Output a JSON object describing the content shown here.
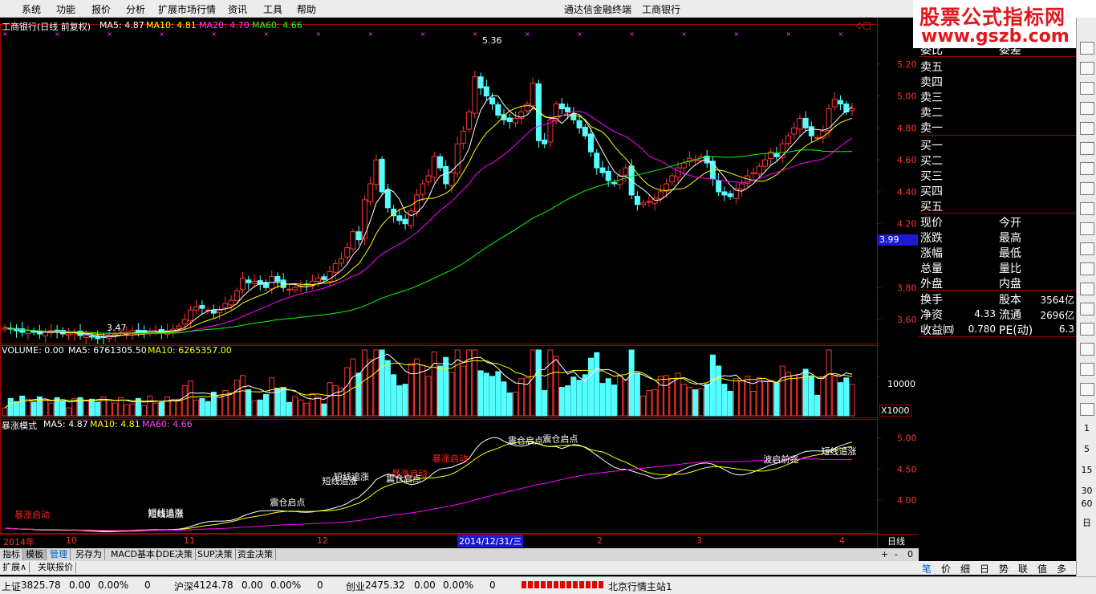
{
  "menu": {
    "items": [
      "系统",
      "功能",
      "报价",
      "分析",
      "扩展市场行情",
      "资讯",
      "工具",
      "帮助"
    ],
    "app_title": "通达信金融终端",
    "stock": "工商银行"
  },
  "watermark": {
    "line1": "股票公式指标网",
    "line2": "www.gszb.com"
  },
  "main_panel": {
    "header_name": "工商银行(日线 前复权)",
    "ma5": "MA5: 4.87",
    "ma10": "MA10: 4.81",
    "ma20": "MA20: 4.70",
    "ma60": "MA60: 4.66",
    "high_label": "5.36",
    "low_label": "3.47",
    "price_flag": "3.99",
    "right_marks": "◇□"
  },
  "volume_panel": {
    "header": "VOLUME: 0.00",
    "ma5": "MA5: 6761305.50",
    "ma10": "MA10: 6265357.00",
    "tick": "10000",
    "unit": "X1000"
  },
  "indicator_panel": {
    "header": "暴涨模式",
    "ma5": "MA5: 4.87",
    "ma10": "MA10: 4.81",
    "ma60": "MA60: 4.66"
  },
  "x_axis": {
    "labels": [
      "2014年",
      "10",
      "11",
      "12",
      "2014/12/31/三",
      "2",
      "3",
      "4"
    ],
    "period": "日线"
  },
  "chart_data": {
    "type": "candlestick",
    "price_axis": {
      "ticks": [
        5.2,
        5.0,
        4.8,
        4.6,
        4.4,
        4.2,
        3.8,
        3.6
      ],
      "range": [
        3.5,
        5.4
      ]
    },
    "indicator_axis": {
      "ticks": [
        5.0,
        4.5,
        4.0
      ],
      "range": [
        3.55,
        5.2
      ]
    },
    "closes": [
      3.55,
      3.54,
      3.53,
      3.52,
      3.53,
      3.52,
      3.51,
      3.52,
      3.53,
      3.52,
      3.51,
      3.51,
      3.52,
      3.5,
      3.5,
      3.49,
      3.48,
      3.49,
      3.5,
      3.51,
      3.52,
      3.52,
      3.53,
      3.52,
      3.52,
      3.53,
      3.53,
      3.52,
      3.53,
      3.54,
      3.56,
      3.6,
      3.66,
      3.68,
      3.67,
      3.66,
      3.64,
      3.66,
      3.7,
      3.72,
      3.78,
      3.86,
      3.83,
      3.84,
      3.82,
      3.8,
      3.87,
      3.84,
      3.8,
      3.79,
      3.8,
      3.81,
      3.82,
      3.84,
      3.86,
      3.85,
      3.9,
      3.95,
      3.98,
      4.05,
      4.15,
      4.1,
      4.35,
      4.45,
      4.6,
      4.4,
      4.3,
      4.25,
      4.22,
      4.2,
      4.28,
      4.38,
      4.45,
      4.5,
      4.62,
      4.55,
      4.45,
      4.52,
      4.7,
      4.78,
      4.9,
      5.12,
      5.05,
      5.0,
      4.95,
      4.88,
      4.85,
      4.84,
      4.86,
      4.9,
      4.95,
      5.08,
      4.72,
      4.7,
      4.85,
      4.95,
      4.92,
      4.9,
      4.85,
      4.8,
      4.75,
      4.65,
      4.55,
      4.52,
      4.47,
      4.45,
      4.5,
      4.55,
      4.38,
      4.32,
      4.33,
      4.34,
      4.36,
      4.4,
      4.45,
      4.5,
      4.55,
      4.58,
      4.61,
      4.6,
      4.62,
      4.58,
      4.48,
      4.4,
      4.38,
      4.37,
      4.42,
      4.45,
      4.5,
      4.52,
      4.56,
      4.6,
      4.65,
      4.62,
      4.7,
      4.75,
      4.8,
      4.86,
      4.8,
      4.75,
      4.74,
      4.78,
      4.92,
      4.98,
      4.95,
      4.9,
      4.92
    ],
    "series": [
      {
        "name": "MA5",
        "value": 4.87
      },
      {
        "name": "MA10",
        "value": 4.81
      },
      {
        "name": "MA20",
        "value": 4.7
      },
      {
        "name": "MA60",
        "value": 4.66
      }
    ],
    "signals": [
      {
        "text": "暴涨启动",
        "color": "#ff2020",
        "x_index": 8,
        "y": 3.68
      },
      {
        "text": "短线追涨",
        "color": "#ffffff",
        "x_index": 44,
        "y": 3.71
      },
      {
        "text": "短线追涨",
        "color": "#ffffff",
        "x_index": 43,
        "y": 3.69
      },
      {
        "text": "震仓启点",
        "color": "#ffffff",
        "x_index": 77,
        "y": 3.88
      },
      {
        "text": "短线追涨",
        "color": "#ffffff",
        "x_index": 93,
        "y": 4.29
      },
      {
        "text": "短线追涨",
        "color": "#ffffff",
        "x_index": 91,
        "y": 4.22
      },
      {
        "text": "暴涨启动",
        "color": "#ff2020",
        "x_index": 110,
        "y": 4.34
      },
      {
        "text": "震仓启点",
        "color": "#ffffff",
        "x_index": 107,
        "y": 4.26
      },
      {
        "text": "暴涨启动",
        "color": "#ff2020",
        "x_index": 121,
        "y": 4.58
      },
      {
        "text": "震仓启点",
        "color": "#ffffff",
        "x_index": 141,
        "y": 4.87
      },
      {
        "text": "震仓启点",
        "color": "#ffffff",
        "x_index": 150,
        "y": 4.9
      },
      {
        "text": "波启前兆",
        "color": "#ffffff",
        "x_index": 209,
        "y": 4.57
      },
      {
        "text": "短线追涨",
        "color": "#ffffff",
        "x_index": 225,
        "y": 4.7
      }
    ]
  },
  "quote": {
    "weibi": "委比",
    "weicha": "委差",
    "sell": [
      "卖五",
      "卖四",
      "卖三",
      "卖二",
      "卖一"
    ],
    "buy": [
      "买一",
      "买二",
      "买三",
      "买四",
      "买五"
    ],
    "xianjia": "现价",
    "jinkai": "今开",
    "zhangdie": "涨跌",
    "zuigao": "最高",
    "zhangfu": "涨幅",
    "zuidi": "最低",
    "zongliang": "总量",
    "liangbi": "量比",
    "waipan": "外盘",
    "neipan": "内盘",
    "huanshou": "换手",
    "guben": "股本",
    "guben_val": "3564亿",
    "jingzi": "净资",
    "jingzi_val": "4.33",
    "liutong": "流通",
    "liutong_val": "2696亿",
    "shouyi": "收益㈣",
    "shouyi_val": "0.780",
    "pe": "PE(动)",
    "pe_val": "6.3"
  },
  "tabs": [
    "指标",
    "模板",
    "管理",
    "另存为",
    "MACD基本",
    "DDE决策",
    "SUP决策",
    "资金决策"
  ],
  "tabs2": [
    "扩展∧",
    "关联报价"
  ],
  "tab_controls": [
    "+",
    "-",
    "0"
  ],
  "right_tabs": [
    "笔",
    "价",
    "细",
    "日",
    "势",
    "联",
    "值",
    "多"
  ],
  "right_numbers": [
    "1",
    "5",
    "15",
    "30",
    "60",
    "日"
  ],
  "status": {
    "sh": "上证",
    "sh_val": "3825.78",
    "sh_chg": "0.00",
    "sh_pct": "0.00%",
    "sh_vol": "0",
    "hs": "沪深",
    "hs_val": "4124.78",
    "hs_chg": "0.00",
    "hs_pct": "0.00%",
    "hs_vol": "0",
    "cy": "创业",
    "cy_val": "2475.32",
    "cy_chg": "0.00",
    "cy_pct": "0.00%",
    "cy_vol": "0",
    "server": "北京行情主站1"
  },
  "colors": {
    "up": "#ff3232",
    "down": "#54ffff",
    "ma5": "#ffffff",
    "ma10": "#ffff00",
    "ma20": "#ff00ff",
    "ma60": "#00ff00",
    "grid": "#a00000"
  }
}
